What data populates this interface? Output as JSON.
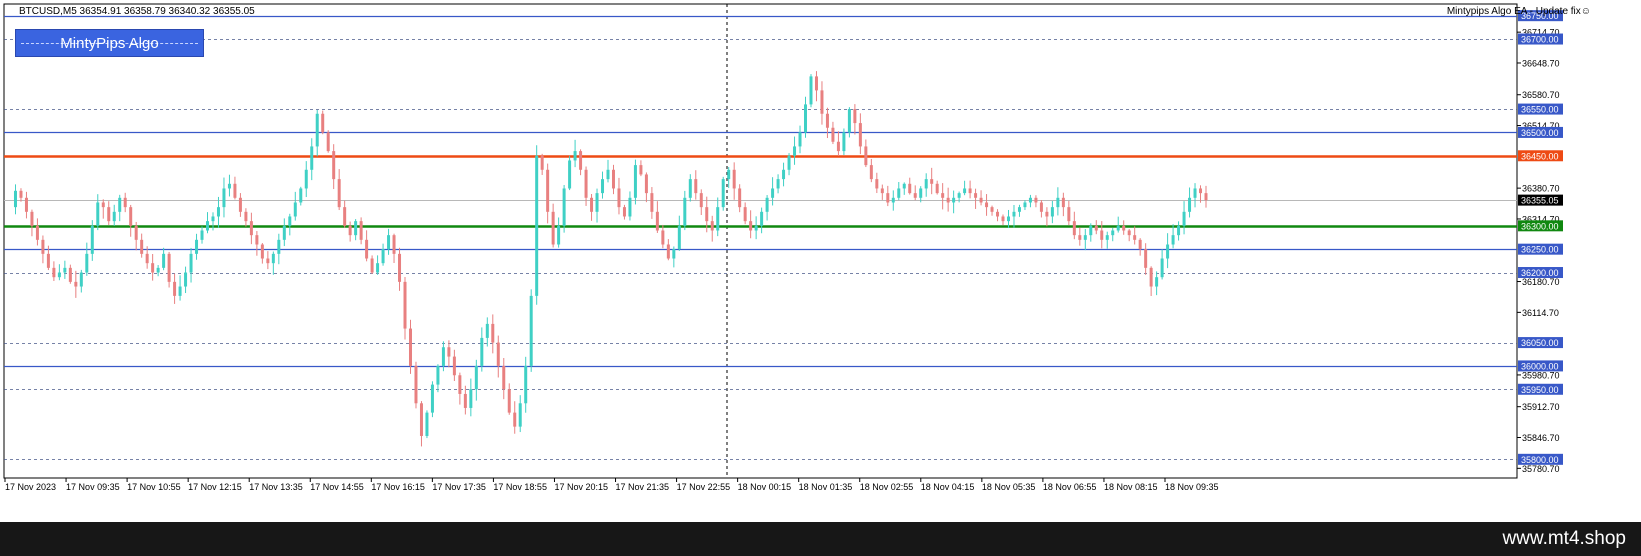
{
  "header": {
    "symbol_info": "BTCUSD,M5  36354.91 36358.79 36340.32 36355.05",
    "ea_name": "Mintypips Algo EA - Update fix☺"
  },
  "ea_button": {
    "label": "MintyPips Algo"
  },
  "footer": {
    "site": "www.mt4.shop"
  },
  "colors": {
    "bull": "#3fd0c5",
    "bear": "#e88080",
    "blue_level": "#3858c8",
    "orange_level": "#ee4a14",
    "green_level": "#108810",
    "current_price_bg": "#000000"
  },
  "chart_data": {
    "type": "candlestick",
    "symbol": "BTCUSD",
    "timeframe": "M5",
    "ylim": [
      35760,
      36775
    ],
    "y_ticks": [
      {
        "price": 36714.7,
        "label": "36714.70"
      },
      {
        "price": 36648.7,
        "label": "36648.70"
      },
      {
        "price": 36580.7,
        "label": "36580.70"
      },
      {
        "price": 36514.7,
        "label": "36514.70"
      },
      {
        "price": 36380.7,
        "label": "36380.70"
      },
      {
        "price": 36314.7,
        "label": "36314.70"
      },
      {
        "price": 36180.7,
        "label": "36180.70"
      },
      {
        "price": 36114.7,
        "label": "36114.70"
      },
      {
        "price": 35980.7,
        "label": "35980.70"
      },
      {
        "price": 35912.7,
        "label": "35912.70"
      },
      {
        "price": 35846.7,
        "label": "35846.70"
      },
      {
        "price": 35780.7,
        "label": "35780.70"
      }
    ],
    "levels": [
      {
        "price": 36750.0,
        "label": "36750.00",
        "style": "solid",
        "kind": "blue"
      },
      {
        "price": 36700.0,
        "label": "36700.00",
        "style": "dashed",
        "kind": "blue"
      },
      {
        "price": 36550.0,
        "label": "36550.00",
        "style": "dashed",
        "kind": "blue"
      },
      {
        "price": 36500.0,
        "label": "36500.00",
        "style": "solid",
        "kind": "blue"
      },
      {
        "price": 36450.0,
        "label": "36450.00",
        "style": "solid",
        "kind": "orange"
      },
      {
        "price": 36300.0,
        "label": "36300.00",
        "style": "solid",
        "kind": "green"
      },
      {
        "price": 36250.0,
        "label": "36250.00",
        "style": "solid",
        "kind": "blue"
      },
      {
        "price": 36200.0,
        "label": "36200.00",
        "style": "dashed",
        "kind": "blue"
      },
      {
        "price": 36050.0,
        "label": "36050.00",
        "style": "dashed",
        "kind": "blue"
      },
      {
        "price": 36000.0,
        "label": "36000.00",
        "style": "solid",
        "kind": "blue"
      },
      {
        "price": 35950.0,
        "label": "35950.00",
        "style": "dashed",
        "kind": "blue"
      },
      {
        "price": 35800.0,
        "label": "35800.00",
        "style": "dashed",
        "kind": "blue"
      }
    ],
    "current_price": {
      "price": 36355.05,
      "label": "36355.05"
    },
    "x_labels": [
      "17 Nov 2023",
      "17 Nov 09:35",
      "17 Nov 10:55",
      "17 Nov 12:15",
      "17 Nov 13:35",
      "17 Nov 14:55",
      "17 Nov 16:15",
      "17 Nov 17:35",
      "17 Nov 18:55",
      "17 Nov 20:15",
      "17 Nov 21:35",
      "17 Nov 22:55",
      "18 Nov 00:15",
      "18 Nov 01:35",
      "18 Nov 02:55",
      "18 Nov 04:15",
      "18 Nov 05:35",
      "18 Nov 06:55",
      "18 Nov 08:15",
      "18 Nov 09:35"
    ],
    "price_path": [
      36340,
      36375,
      36360,
      36330,
      36300,
      36270,
      36240,
      36210,
      36190,
      36200,
      36210,
      36180,
      36170,
      36200,
      36240,
      36300,
      36350,
      36340,
      36310,
      36330,
      36360,
      36340,
      36300,
      36270,
      36240,
      36220,
      36200,
      36210,
      36240,
      36180,
      36150,
      36170,
      36200,
      36240,
      36270,
      36290,
      36310,
      36320,
      36340,
      36380,
      36390,
      36360,
      36330,
      36310,
      36280,
      36260,
      36230,
      36220,
      36240,
      36270,
      36300,
      36320,
      36350,
      36380,
      36420,
      36470,
      36540,
      36500,
      36460,
      36400,
      36340,
      36300,
      36280,
      36310,
      36270,
      36230,
      36200,
      36220,
      36250,
      36280,
      36240,
      36180,
      36080,
      36000,
      35920,
      35850,
      35900,
      35960,
      36000,
      36040,
      36020,
      35980,
      35940,
      35910,
      35950,
      36000,
      36060,
      36090,
      36050,
      36000,
      35950,
      35900,
      35870,
      35920,
      36000,
      36150,
      36450,
      36420,
      36330,
      36260,
      36300,
      36380,
      36440,
      36460,
      36420,
      36360,
      36330,
      36370,
      36400,
      36420,
      36380,
      36340,
      36320,
      36360,
      36430,
      36410,
      36370,
      36330,
      36290,
      36260,
      36230,
      36250,
      36300,
      36360,
      36400,
      36370,
      36340,
      36310,
      36290,
      36340,
      36400,
      36420,
      36380,
      36340,
      36310,
      36290,
      36300,
      36330,
      36360,
      36380,
      36400,
      36420,
      36450,
      36470,
      36500,
      36560,
      36620,
      36590,
      36540,
      36510,
      36480,
      36460,
      36500,
      36550,
      36520,
      36470,
      36430,
      36400,
      36380,
      36370,
      36350,
      36360,
      36380,
      36390,
      36370,
      36360,
      36380,
      36400,
      36390,
      36370,
      36360,
      36350,
      36360,
      36370,
      36380,
      36370,
      36360,
      36350,
      36340,
      36330,
      36320,
      36310,
      36320,
      36330,
      36340,
      36350,
      36360,
      36350,
      36330,
      36320,
      36340,
      36360,
      36340,
      36310,
      36280,
      36270,
      36280,
      36300,
      36290,
      36270,
      36280,
      36290,
      36300,
      36290,
      36280,
      36270,
      36250,
      36210,
      36170,
      36190,
      36230,
      36260,
      36280,
      36300,
      36330,
      36360,
      36380,
      36370,
      36355
    ]
  }
}
